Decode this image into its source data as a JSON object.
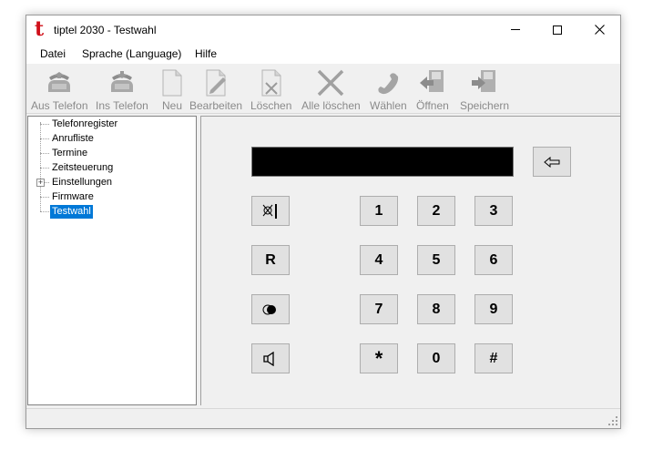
{
  "window": {
    "app_icon": "t",
    "title": "tiptel 2030 - Testwahl",
    "controls": [
      "minimize-icon",
      "maximize-icon",
      "close-icon"
    ]
  },
  "menu": [
    "Datei",
    "Sprache (Language)",
    "Hilfe"
  ],
  "toolbar": [
    {
      "label": "Aus Telefon",
      "icon": "phone-download-icon"
    },
    {
      "label": "Ins Telefon",
      "icon": "phone-upload-icon"
    },
    {
      "label": "Neu",
      "icon": "new-document-icon"
    },
    {
      "label": "Bearbeiten",
      "icon": "edit-document-icon"
    },
    {
      "label": "Löschen",
      "icon": "delete-document-icon"
    },
    {
      "label": "Alle löschen",
      "icon": "delete-all-icon"
    },
    {
      "label": "Wählen",
      "icon": "dial-handset-icon"
    },
    {
      "label": "Öffnen",
      "icon": "open-file-icon"
    },
    {
      "label": "Speichern",
      "icon": "save-file-icon"
    }
  ],
  "tree": {
    "items": [
      "Telefonregister",
      "Anrufliste",
      "Termine",
      "Zeitsteuerung",
      "Einstellungen",
      "Firmware",
      "Testwahl"
    ],
    "expander": "+",
    "selected": "Testwahl"
  },
  "dialpad": {
    "display_value": "",
    "backspace_icon": "backspace-arrow-icon",
    "function_keys": [
      {
        "name": "mute-key",
        "icon": "mute-icon",
        "label": ""
      },
      {
        "name": "recall-key",
        "icon": "",
        "label": "R"
      },
      {
        "name": "record-key",
        "icon": "record-icon",
        "label": ""
      },
      {
        "name": "speaker-key",
        "icon": "speaker-icon",
        "label": ""
      }
    ],
    "keys": [
      "1",
      "2",
      "3",
      "4",
      "5",
      "6",
      "7",
      "8",
      "9",
      "*",
      "0",
      "#"
    ]
  },
  "colors": {
    "accent": "#0078d7",
    "brand": "#d0101a",
    "display": "#000000"
  }
}
